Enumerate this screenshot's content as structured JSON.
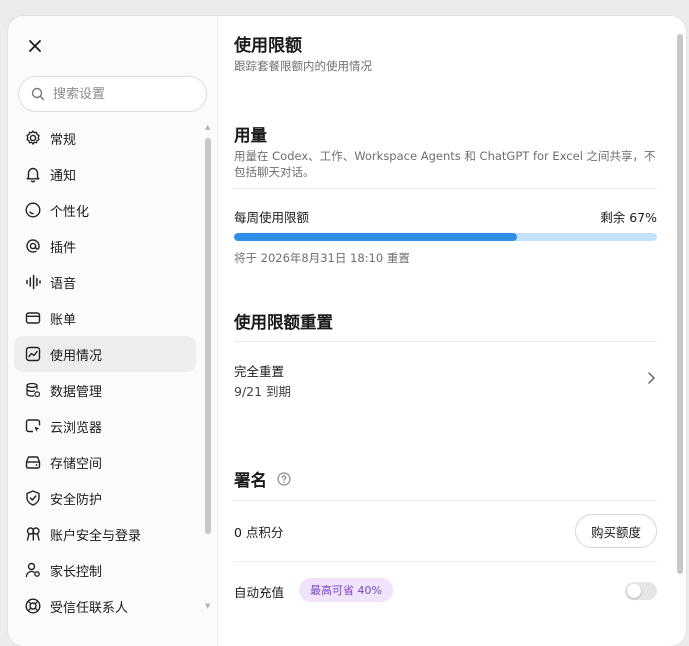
{
  "sidebar": {
    "search_placeholder": "搜索设置",
    "items": [
      {
        "label": "常规",
        "icon": "gear-icon"
      },
      {
        "label": "通知",
        "icon": "bell-icon"
      },
      {
        "label": "个性化",
        "icon": "personalize-icon"
      },
      {
        "label": "插件",
        "icon": "at-icon"
      },
      {
        "label": "语音",
        "icon": "waveform-icon"
      },
      {
        "label": "账单",
        "icon": "card-icon"
      },
      {
        "label": "使用情况",
        "icon": "chart-icon",
        "active": true
      },
      {
        "label": "数据管理",
        "icon": "database-icon"
      },
      {
        "label": "云浏览器",
        "icon": "browser-icon"
      },
      {
        "label": "存储空间",
        "icon": "storage-icon"
      },
      {
        "label": "安全防护",
        "icon": "shield-icon"
      },
      {
        "label": "账户安全与登录",
        "icon": "account-icon"
      },
      {
        "label": "家长控制",
        "icon": "parent-icon"
      },
      {
        "label": "受信任联系人",
        "icon": "contact-icon"
      }
    ]
  },
  "main": {
    "title": "使用限额",
    "subtitle": "跟踪套餐限额内的使用情况",
    "usage": {
      "heading": "用量",
      "description": "用量在 Codex、工作、Workspace Agents 和 ChatGPT for Excel 之间共享，不包括聊天对话。",
      "weekly_label": "每周使用限额",
      "remaining_label": "剩余 67%",
      "used_fraction": 0.67,
      "reset_note": "将于 2026年8月31日 18:10 重置"
    },
    "reset": {
      "heading": "使用限额重置",
      "item_title": "完全重置",
      "item_expiry": "9/21 到期"
    },
    "sign": {
      "heading": "署名",
      "points": "0 点积分",
      "buy_button": "购买额度",
      "auto_recharge": "自动充值",
      "badge": "最高可省 40%",
      "auto_recharge_on": false
    }
  },
  "colors": {
    "accent": "#2f8fe6",
    "track": "#c4e1fa",
    "badge_bg": "#efe4fb",
    "badge_text": "#7c45c7",
    "active_nav": "#ededed"
  }
}
